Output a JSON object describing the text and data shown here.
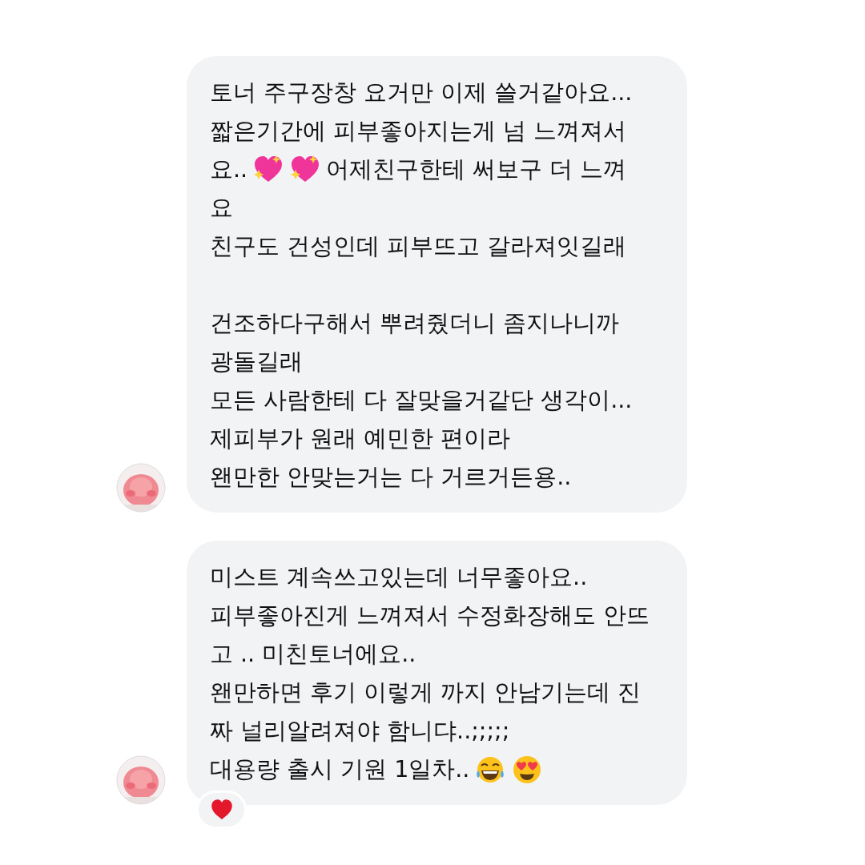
{
  "messages": [
    {
      "reacted": false,
      "lines": [
        [
          {
            "kind": "text",
            "text": "토너 주구장창 요거만 이제 쓸거같아요..."
          }
        ],
        [
          {
            "kind": "text",
            "text": "짧은기간에 피부좋아지는게 넘 느껴져서"
          }
        ],
        [
          {
            "kind": "text",
            "text": "요.."
          },
          {
            "kind": "heart"
          },
          {
            "kind": "heart"
          },
          {
            "kind": "text",
            "text": "어제친구한테 써보구 더 느껴"
          }
        ],
        [
          {
            "kind": "text",
            "text": "요"
          }
        ],
        [
          {
            "kind": "text",
            "text": "친구도 건성인데 피부뜨고 갈라져잇길래"
          }
        ],
        [
          {
            "kind": "blank"
          }
        ],
        [
          {
            "kind": "text",
            "text": "건조하다구해서 뿌려줬더니 좀지나니까"
          }
        ],
        [
          {
            "kind": "text",
            "text": "광돌길래"
          }
        ],
        [
          {
            "kind": "text",
            "text": "모든 사람한테 다 잘맞을거같단 생각이..."
          }
        ],
        [
          {
            "kind": "text",
            "text": "제피부가 원래 예민한 편이라"
          }
        ],
        [
          {
            "kind": "text",
            "text": "왠만한 안맞는거는 다 거르거든용.."
          }
        ]
      ]
    },
    {
      "reacted": true,
      "lines": [
        [
          {
            "kind": "text",
            "text": "미스트 계속쓰고있는데 너무좋아요.."
          }
        ],
        [
          {
            "kind": "text",
            "text": "피부좋아진게 느껴져서 수정화장해도 안뜨"
          }
        ],
        [
          {
            "kind": "text",
            "text": "고 .. 미친토너에요.."
          }
        ],
        [
          {
            "kind": "text",
            "text": "왠만하면 후기 이렇게 까지 안남기는데 진"
          }
        ],
        [
          {
            "kind": "text",
            "text": "짜 널리알려져야 함니댜..;;;;;"
          }
        ],
        [
          {
            "kind": "text",
            "text": "대용량 출시 기원 1일차.."
          },
          {
            "kind": "laugh"
          },
          {
            "kind": "hearteyes"
          }
        ]
      ]
    }
  ]
}
